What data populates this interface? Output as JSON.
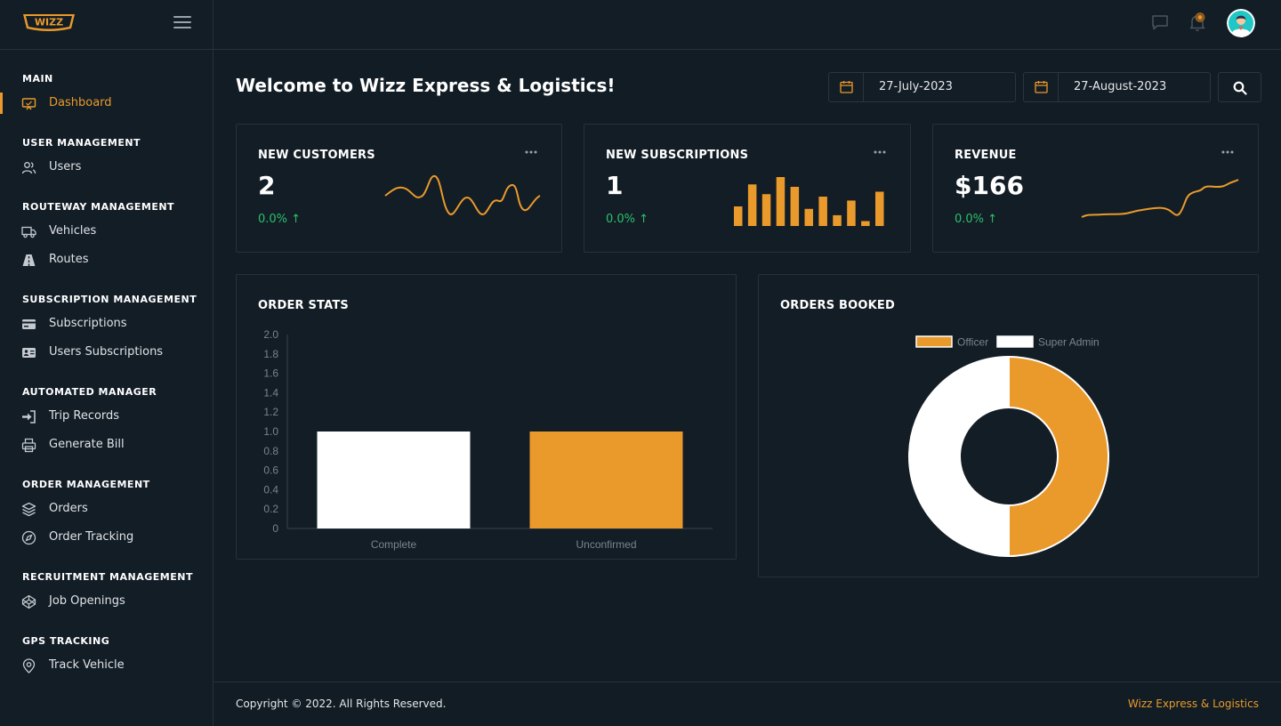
{
  "app": {
    "logo_text": "WIZZ",
    "page_title": "Welcome to Wizz Express & Logistics!"
  },
  "sidebar": {
    "sections": [
      {
        "title": "MAIN",
        "items": [
          {
            "label": "Dashboard",
            "icon": "monitor-icon",
            "active": true
          }
        ]
      },
      {
        "title": "USER MANAGEMENT",
        "items": [
          {
            "label": "Users",
            "icon": "users-icon"
          }
        ]
      },
      {
        "title": "ROUTEWAY MANAGEMENT",
        "items": [
          {
            "label": "Vehicles",
            "icon": "truck-icon"
          },
          {
            "label": "Routes",
            "icon": "road-icon"
          }
        ]
      },
      {
        "title": "SUBSCRIPTION MANAGEMENT",
        "items": [
          {
            "label": "Subscriptions",
            "icon": "credit-card-icon"
          },
          {
            "label": "Users Subscriptions",
            "icon": "id-card-icon"
          }
        ]
      },
      {
        "title": "AUTOMATED MANAGER",
        "items": [
          {
            "label": "Trip Records",
            "icon": "sign-in-icon"
          },
          {
            "label": "Generate Bill",
            "icon": "printer-icon"
          }
        ]
      },
      {
        "title": "ORDER MANAGEMENT",
        "items": [
          {
            "label": "Orders",
            "icon": "layers-icon"
          },
          {
            "label": "Order Tracking",
            "icon": "compass-icon"
          }
        ]
      },
      {
        "title": "RECRUITMENT MANAGEMENT",
        "items": [
          {
            "label": "Job Openings",
            "icon": "codepen-icon"
          }
        ]
      },
      {
        "title": "GPS TRACKING",
        "items": [
          {
            "label": "Track Vehicle",
            "icon": "map-pin-icon"
          }
        ]
      }
    ]
  },
  "filters": {
    "start_date": "27-July-2023",
    "end_date": "27-August-2023"
  },
  "stats": [
    {
      "title": "NEW CUSTOMERS",
      "value": "2",
      "change": "0.0% ↑"
    },
    {
      "title": "NEW SUBSCRIPTIONS",
      "value": "1",
      "change": "0.0% ↑"
    },
    {
      "title": "REVENUE",
      "value": "$166",
      "change": "0.0% ↑"
    }
  ],
  "sparkline_bars": [
    0.4,
    0.85,
    0.65,
    1.0,
    0.8,
    0.35,
    0.6,
    0.22,
    0.52,
    0.1,
    0.7
  ],
  "order_stats": {
    "title": "ORDER STATS"
  },
  "orders_booked": {
    "title": "ORDERS BOOKED"
  },
  "chart_data": [
    {
      "type": "bar",
      "title": "ORDER STATS",
      "categories": [
        "Complete",
        "Unconfirmed"
      ],
      "values": [
        1,
        1
      ],
      "colors": [
        "#ffffff",
        "#ea9a2b"
      ],
      "ylim": [
        0,
        2.0
      ],
      "yticks": [
        "2.0",
        "1.8",
        "1.6",
        "1.4",
        "1.2",
        "1.0",
        "0.8",
        "0.6",
        "0.4",
        "0.2",
        "0"
      ],
      "grid": false
    },
    {
      "type": "pie",
      "title": "ORDERS BOOKED",
      "donut": true,
      "labels": [
        "Officer",
        "Super Admin"
      ],
      "values": [
        1,
        1
      ],
      "colors": [
        "#ea9a2b",
        "#ffffff"
      ],
      "legend": "top"
    }
  ],
  "footer": {
    "copyright": "Copyright © 2022. All Rights Reserved.",
    "brand": "Wizz Express & Logistics"
  },
  "colors": {
    "accent": "#ea9a2b",
    "positive": "#2bc06a",
    "background": "#111c24",
    "panel": "#131d26"
  }
}
